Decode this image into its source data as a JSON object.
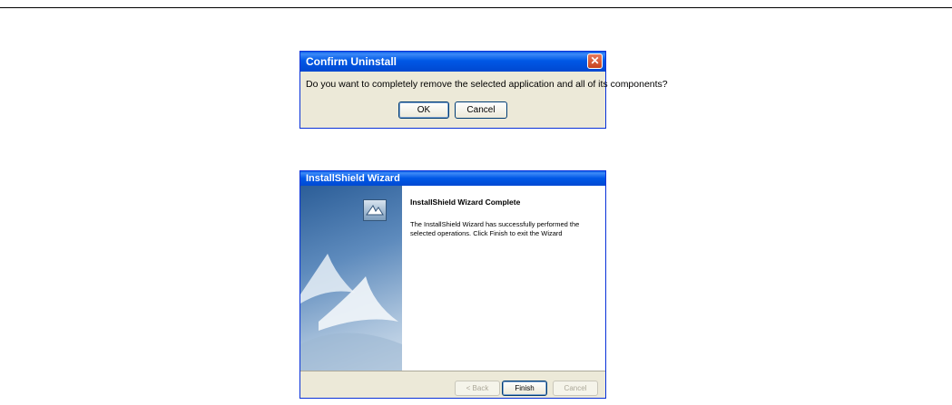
{
  "confirm_dialog": {
    "title": "Confirm Uninstall",
    "close_glyph": "✕",
    "message": "Do you want to completely remove the selected application and all of its components?",
    "ok_label": "OK",
    "cancel_label": "Cancel"
  },
  "wizard": {
    "title": "InstallShield Wizard",
    "heading": "InstallShield Wizard Complete",
    "body": "The InstallShield Wizard has successfully performed the selected operations.  Click Finish to exit the Wizard",
    "back_label": "< Back",
    "finish_label": "Finish",
    "cancel_label": "Cancel"
  },
  "colors": {
    "title_bar_blue": "#0058e6",
    "dialog_face": "#ece9d8",
    "close_red": "#c8431d"
  }
}
